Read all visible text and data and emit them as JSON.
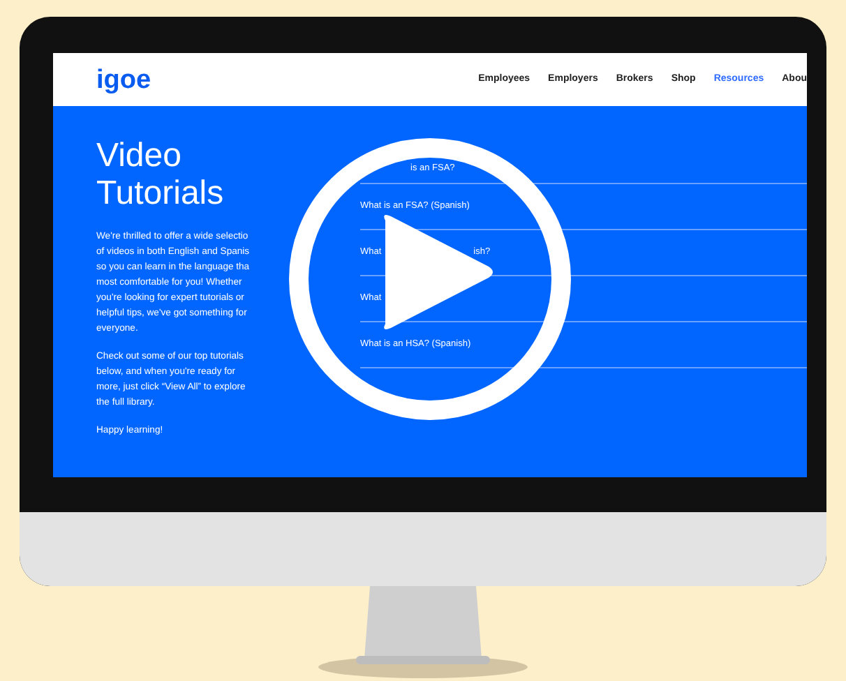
{
  "site": {
    "logo": "igoe",
    "nav": [
      {
        "label": "Employees",
        "selected": false
      },
      {
        "label": "Employers",
        "selected": false
      },
      {
        "label": "Brokers",
        "selected": false
      },
      {
        "label": "Shop",
        "selected": false
      },
      {
        "label": "Resources",
        "selected": true
      },
      {
        "label": "Abou",
        "selected": false
      }
    ],
    "title_lines": [
      "Video",
      "Tutorials"
    ],
    "paragraphs": [
      [
        "We're thrilled to offer a wide selectio",
        "of videos in both English and Spanis",
        "so you can learn in the language tha",
        "most comfortable for you! Whether",
        "you're looking for expert tutorials or",
        "helpful tips, we've got something for",
        "everyone."
      ],
      [
        "Check out some of our top tutorials",
        "below, and when you're ready for",
        "more, just click “View All” to explore",
        "the full library."
      ],
      [
        "Happy learning!"
      ]
    ],
    "videos": [
      {
        "end": "is an FSA?"
      },
      {
        "start": "What is an FSA? (Spanish)"
      },
      {
        "start": "What",
        "end": "ish?"
      },
      {
        "start": "What"
      },
      {
        "start": "What is an HSA? (Spanish)"
      }
    ]
  }
}
